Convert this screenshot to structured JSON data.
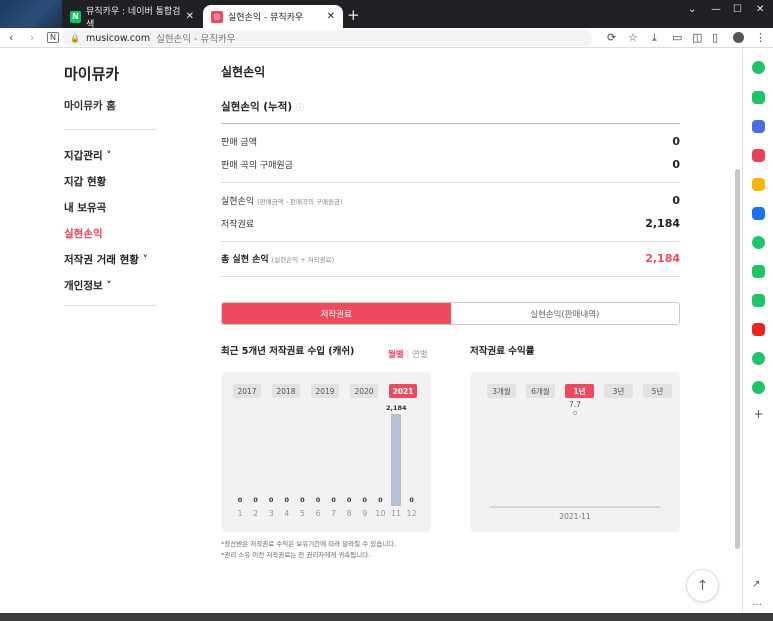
{
  "browser": {
    "tabs": [
      {
        "label": "뮤직카우 : 네이버 통합검색",
        "icon": "naver-icon",
        "color": "#03c75a"
      },
      {
        "label": "실현손익 - 뮤직카우",
        "icon": "musicow-icon",
        "color": "#ee4a5d"
      }
    ],
    "url_domain": "musicow.com",
    "url_rest": "실현손익 - 뮤직카우"
  },
  "sidebar": {
    "title": "마이뮤카",
    "home": "마이뮤카 홈",
    "items": [
      {
        "label": "지갑관리 ˅"
      },
      {
        "label": "지갑 현황"
      },
      {
        "label": "내 보유곡"
      },
      {
        "label": "실현손익"
      },
      {
        "label": "저작권 거래 현황 ˅"
      },
      {
        "label": "개인정보 ˅"
      }
    ]
  },
  "main": {
    "title": "실현손익",
    "subtitle": "실현손익 (누적)",
    "rows": [
      {
        "label": "판매 금액",
        "note": "",
        "value": "0"
      },
      {
        "label": "판매 곡의 구매원금",
        "note": "",
        "value": "0"
      },
      {
        "label": "실현손익",
        "note": "(판매금액 - 판매곡의 구매원금)",
        "value": "0"
      },
      {
        "label": "저작권료",
        "note": "",
        "value": "2,184"
      },
      {
        "label": "총 실현 손익",
        "note": "(실현손익 + 저작권료)",
        "value": "2,184"
      }
    ],
    "tabs": [
      "저작권료",
      "실현손익(판매내역)"
    ],
    "left_chart_title": "최근 5개년 저작권료 수입 (캐쉬)",
    "toggle": {
      "monthly": "월별",
      "separator": "|",
      "yearly": "연별"
    },
    "right_chart_title": "저작권료 수익률",
    "notes": [
      "*정산받은 저작권료 수익은 보유기간에 따라 달라질 수 있습니다.",
      "*권리 소유 이전 저작권료는 전 권리자에게 귀속됩니다."
    ]
  },
  "chart_data": [
    {
      "type": "bar",
      "years": [
        "2017",
        "2018",
        "2019",
        "2020",
        "2021"
      ],
      "selected_year": "2021",
      "categories": [
        "1",
        "2",
        "3",
        "4",
        "5",
        "6",
        "7",
        "8",
        "9",
        "10",
        "11",
        "12"
      ],
      "values": [
        0,
        0,
        0,
        0,
        0,
        0,
        0,
        0,
        0,
        0,
        2184,
        0
      ],
      "value_labels": [
        "0",
        "0",
        "0",
        "0",
        "0",
        "0",
        "0",
        "0",
        "0",
        "0",
        "2,184",
        "0"
      ],
      "bar_color": "#b4c1d3"
    },
    {
      "type": "scatter",
      "periods": [
        "3개월",
        "6개월",
        "1년",
        "3년",
        "5년"
      ],
      "selected_period": "1년",
      "x": [
        "2021-11"
      ],
      "y": [
        7.7
      ],
      "value_labels": [
        "7.7"
      ]
    }
  ],
  "colors": {
    "accent": "#ee4a5d"
  }
}
